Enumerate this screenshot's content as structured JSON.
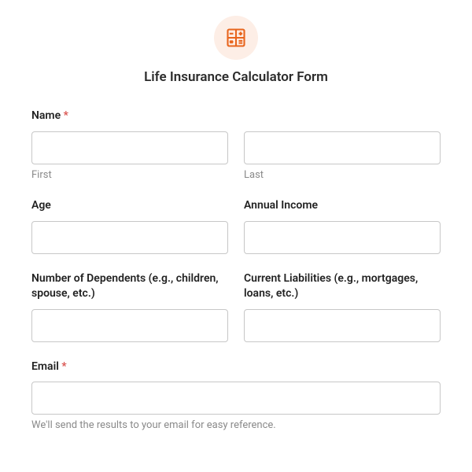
{
  "header": {
    "title": "Life Insurance Calculator Form"
  },
  "fields": {
    "name": {
      "label": "Name",
      "required": "*",
      "first_sub": "First",
      "last_sub": "Last"
    },
    "age": {
      "label": "Age"
    },
    "income": {
      "label": "Annual Income"
    },
    "dependents": {
      "label": "Number of Dependents (e.g., children, spouse, etc.)"
    },
    "liabilities": {
      "label": "Current Liabilities (e.g., mortgages, loans, etc.)"
    },
    "email": {
      "label": "Email",
      "required": "*",
      "help": "We'll send the results to your email for easy reference."
    }
  }
}
